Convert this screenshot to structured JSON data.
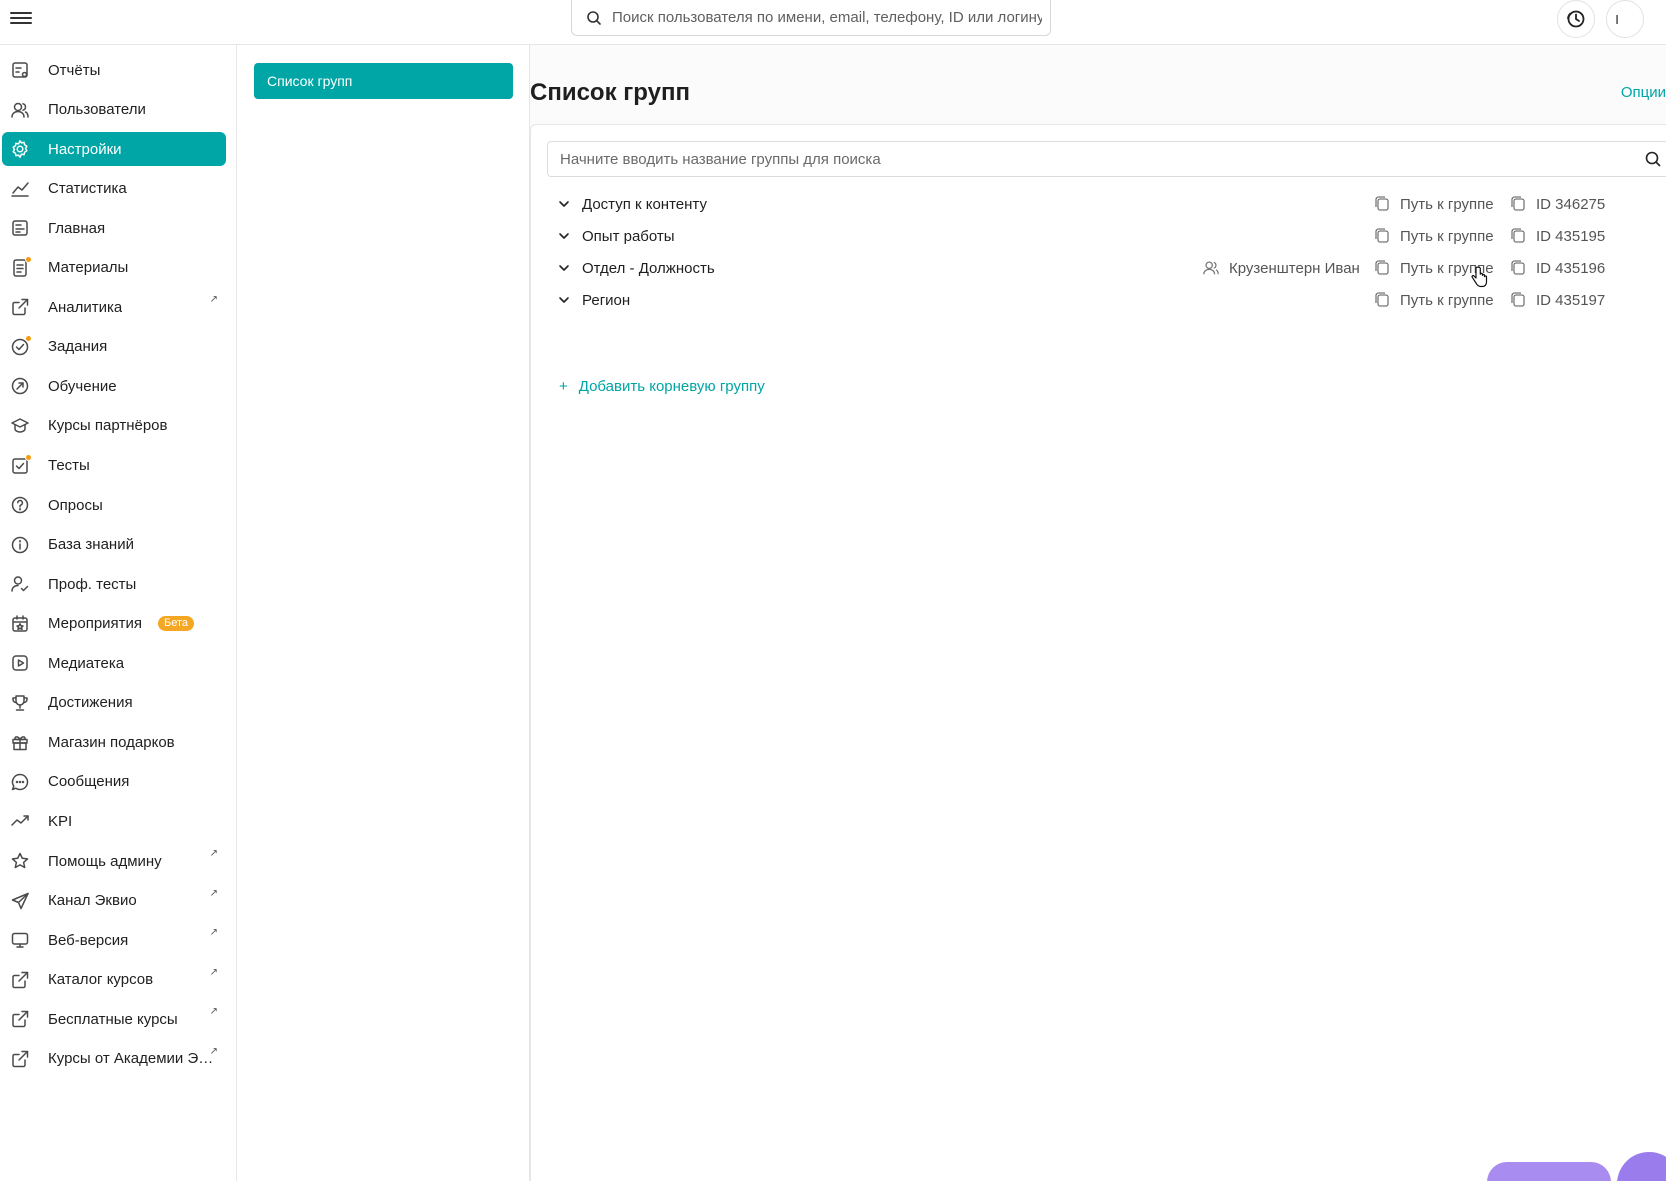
{
  "topbar": {
    "search_placeholder": "Поиск пользователя по имени, email, телефону, ID или логину",
    "profile_letter": "I"
  },
  "sidebar": {
    "items": [
      {
        "label": "Отчёты",
        "icon": "report-icon"
      },
      {
        "label": "Пользователи",
        "icon": "users-icon"
      },
      {
        "label": "Настройки",
        "icon": "gear-icon",
        "active": true
      },
      {
        "label": "Статистика",
        "icon": "line-chart-icon"
      },
      {
        "label": "Главная",
        "icon": "home-feed-icon"
      },
      {
        "label": "Материалы",
        "icon": "document-icon",
        "dot": true
      },
      {
        "label": "Аналитика",
        "icon": "external-icon",
        "external": true
      },
      {
        "label": "Задания",
        "icon": "task-icon",
        "dot": true
      },
      {
        "label": "Обучение",
        "icon": "learning-icon"
      },
      {
        "label": "Курсы партнёров",
        "icon": "graduation-cap-icon"
      },
      {
        "label": "Тесты",
        "icon": "test-icon",
        "dot": true
      },
      {
        "label": "Опросы",
        "icon": "question-icon"
      },
      {
        "label": "База знаний",
        "icon": "info-icon"
      },
      {
        "label": "Проф. тесты",
        "icon": "user-check-icon"
      },
      {
        "label": "Мероприятия",
        "icon": "calendar-icon",
        "badge": "Бета"
      },
      {
        "label": "Медиатека",
        "icon": "play-icon"
      },
      {
        "label": "Достижения",
        "icon": "trophy-icon"
      },
      {
        "label": "Магазин подарков",
        "icon": "gift-icon"
      },
      {
        "label": "Сообщения",
        "icon": "chat-icon"
      },
      {
        "label": "KPI",
        "icon": "trend-icon"
      },
      {
        "label": "Помощь админу",
        "icon": "star-icon",
        "external": true
      },
      {
        "label": "Канал Эквио",
        "icon": "send-icon",
        "external": true
      },
      {
        "label": "Веб-версия",
        "icon": "monitor-icon",
        "external": true
      },
      {
        "label": "Каталог курсов",
        "icon": "external-icon",
        "external": true
      },
      {
        "label": "Бесплатные курсы",
        "icon": "external-icon",
        "external": true
      },
      {
        "label": "Курсы от Академии Экв...",
        "icon": "external-icon",
        "external": true
      }
    ],
    "external_mark": "↗"
  },
  "submenu": {
    "items": [
      {
        "label": "Список групп"
      }
    ]
  },
  "main": {
    "title": "Список групп",
    "options_label": "Опции",
    "group_search_placeholder": "Начните вводить название группы для поиска",
    "path_label": "Путь к группе",
    "groups": [
      {
        "name": "Доступ к контенту",
        "id": "ID 346275",
        "owner": ""
      },
      {
        "name": "Опыт работы",
        "id": "ID 435195",
        "owner": ""
      },
      {
        "name": "Отдел - Должность",
        "id": "ID 435196",
        "owner": "Крузенштерн Иван"
      },
      {
        "name": "Регион",
        "id": "ID 435197",
        "owner": ""
      }
    ],
    "add_root_label": "Добавить корневую группу",
    "add_root_plus": "+"
  },
  "colors": {
    "accent": "#00a6a6",
    "badge": "#f5a623",
    "dot": "#f39c12"
  }
}
